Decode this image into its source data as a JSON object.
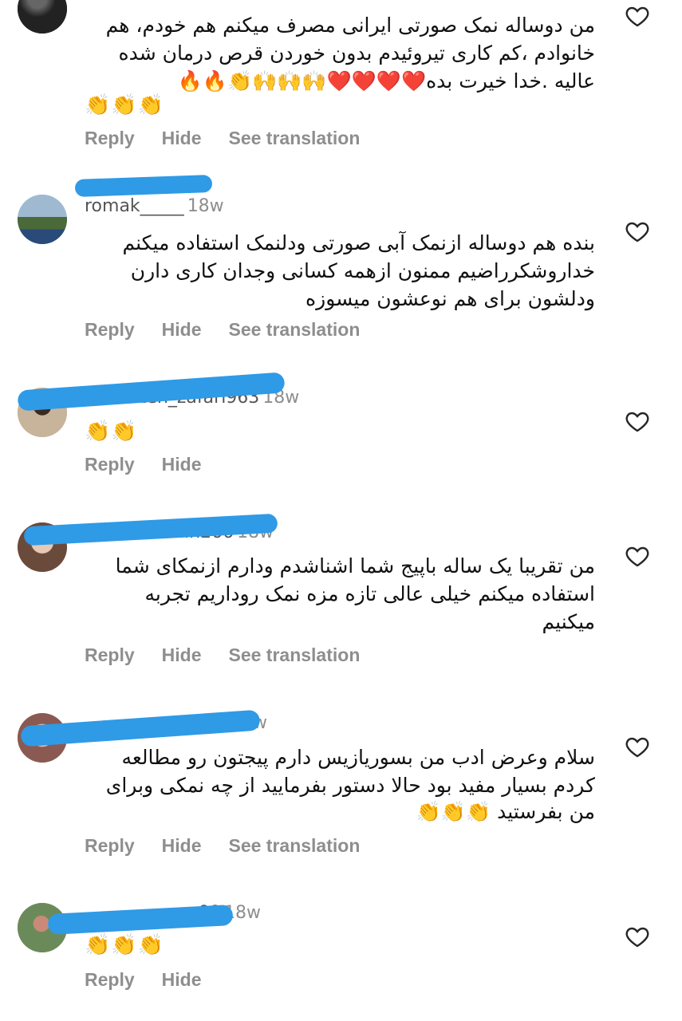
{
  "actions": {
    "reply": "Reply",
    "hide": "Hide",
    "see_translation": "See translation"
  },
  "comments": [
    {
      "username": "",
      "time": "",
      "lines": [
        "من دوساله نمک صورتی ایرانی مصرف میکنم هم خودم، هم",
        "خانوادم ،کم کاری تیروئیدم  بدون خوردن قرص درمان شده",
        "عالیه .خدا خیرت بده❤️❤️❤️❤️🙌🙌🙌👏🔥🔥"
      ],
      "emoji_line": "👏👏👏",
      "has_translation": true
    },
    {
      "username": "romak_____",
      "time": "18w",
      "lines": [
        "بنده هم دوساله ازنمک آبی صورتی ودلنمک استفاده میکنم",
        "خداروشکرراضیم ممنون ازهمه کسانی وجدان کاری دارن",
        "ودلشون برای هم نوعشون میسوزه"
      ],
      "has_translation": true
    },
    {
      "username": "fereshteh_zafari963",
      "time": "18w",
      "emoji_line": "👏👏",
      "has_translation": false
    },
    {
      "username": "azadinazanin266",
      "time": "18w",
      "lines": [
        "من تقریبا یک ساله باپیج شما اشناشدم ودارم ازنمکای شما",
        "استفاده میکنم خیلی عالی تازه مزه نمک روداریم تجربه",
        "میکنیم"
      ],
      "has_translation": true
    },
    {
      "username": "_______________2",
      "time": "18w",
      "lines": [
        "سلام وعرض ادب  من بسوریازیس دارم پیجتون رو مطالعه",
        "کردم بسیار مفید بود حالا دستور بفرمایید از چه نمکی وبرای",
        "من بفرستید 👏👏👏"
      ],
      "has_translation": true
    },
    {
      "username": "_____________99",
      "time": "18w",
      "emoji_line": "👏👏👏",
      "has_translation": false
    }
  ]
}
